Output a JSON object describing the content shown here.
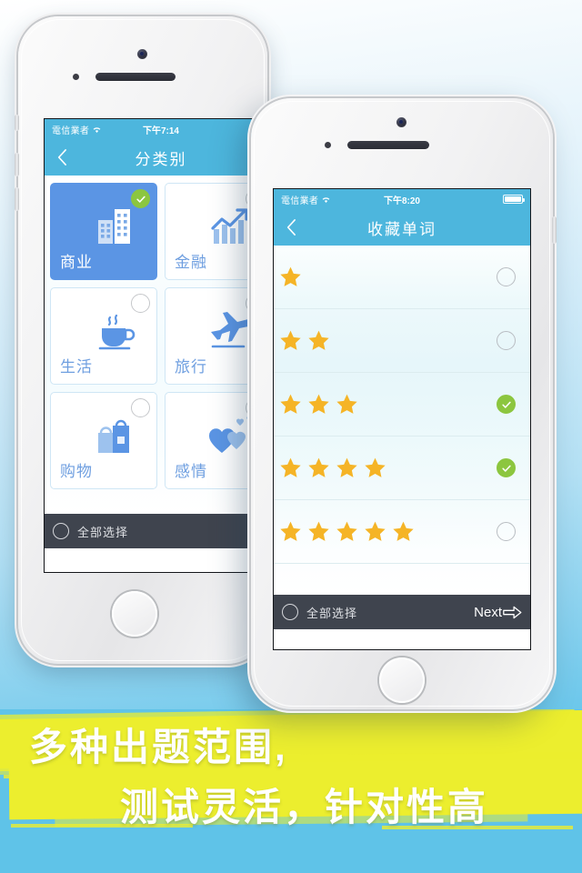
{
  "background": {
    "gradient_top": "#ffffff",
    "gradient_bottom": "#55bfe8"
  },
  "theme": {
    "nav_blue": "#4db6dd",
    "card_selected_blue": "#5b95e4",
    "check_green": "#8cc63f",
    "toolbar_dark": "#3f444e",
    "star_gold": "#f5b426",
    "banner_yellow": "#ecee2e",
    "icon_blue": "#6f9fe0"
  },
  "phone_back": {
    "status": {
      "carrier": "電信業者",
      "wifi_icon": "wifi-icon",
      "time": "下午7:14",
      "battery_icon": "battery-icon"
    },
    "nav": {
      "back_icon": "chevron-left-icon",
      "title": "分类别"
    },
    "categories": [
      {
        "label": "商业",
        "icon": "buildings-icon",
        "selected": true
      },
      {
        "label": "金融",
        "icon": "bar-chart-icon",
        "selected": false
      },
      {
        "label": "生活",
        "icon": "coffee-cup-icon",
        "selected": false
      },
      {
        "label": "旅行",
        "icon": "airplane-icon",
        "selected": false
      },
      {
        "label": "购物",
        "icon": "shopping-bag-icon",
        "selected": false
      },
      {
        "label": "感情",
        "icon": "hearts-icon",
        "selected": false
      }
    ],
    "toolbar": {
      "select_all_icon": "circle-unchecked-icon",
      "select_all_label": "全部选择"
    }
  },
  "phone_front": {
    "status": {
      "carrier": "電信業者",
      "wifi_icon": "wifi-icon",
      "time": "下午8:20",
      "battery_icon": "battery-icon"
    },
    "nav": {
      "back_icon": "chevron-left-icon",
      "title": "收藏单词"
    },
    "star_rows": [
      {
        "stars": 1,
        "checked": false
      },
      {
        "stars": 2,
        "checked": false
      },
      {
        "stars": 3,
        "checked": true
      },
      {
        "stars": 4,
        "checked": true
      },
      {
        "stars": 5,
        "checked": false
      }
    ],
    "toolbar": {
      "select_all_icon": "circle-unchecked-icon",
      "select_all_label": "全部选择",
      "next_label": "Next",
      "next_icon": "arrow-right-icon"
    }
  },
  "banner": {
    "line1": "多种出题范围,",
    "line2": "测试灵活，针对性高"
  }
}
